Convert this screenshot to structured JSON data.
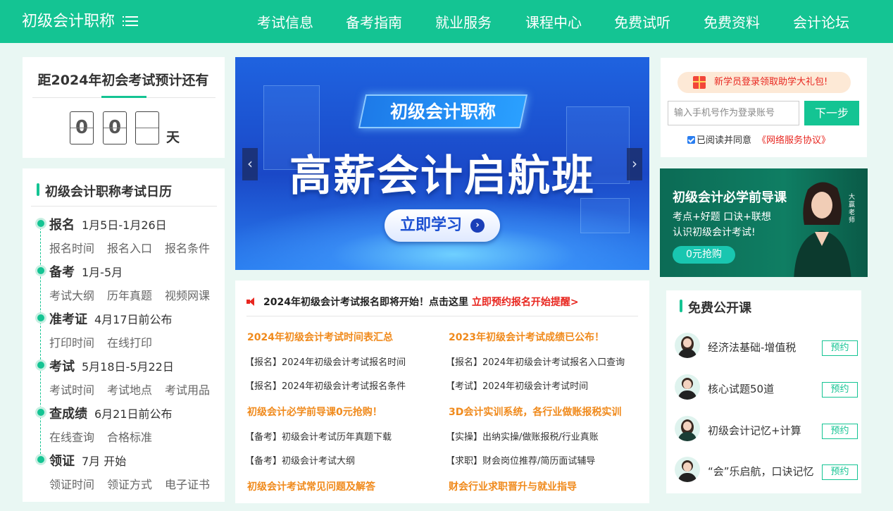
{
  "header": {
    "brand": "初级会计职称",
    "nav": [
      "考试信息",
      "备考指南",
      "就业服务",
      "课程中心",
      "免费试听",
      "免费资料",
      "会计论坛"
    ]
  },
  "countdown": {
    "title": "距2024年初会考试预计还有",
    "digits": [
      "0",
      "0",
      ""
    ],
    "unit": "天"
  },
  "calendar": {
    "title": "初级会计职称考试日历",
    "items": [
      {
        "name": "报名",
        "date": "1月5日-1月26日",
        "links": [
          "报名时间",
          "报名入口",
          "报名条件"
        ]
      },
      {
        "name": "备考",
        "date": "1月-5月",
        "links": [
          "考试大纲",
          "历年真题",
          "视频网课"
        ]
      },
      {
        "name": "准考证",
        "date": "4月17日前公布",
        "links": [
          "打印时间",
          "在线打印"
        ]
      },
      {
        "name": "考试",
        "date": "5月18日-5月22日",
        "links": [
          "考试时间",
          "考试地点",
          "考试用品"
        ]
      },
      {
        "name": "查成绩",
        "date": "6月21日前公布",
        "links": [
          "在线查询",
          "合格标准"
        ]
      },
      {
        "name": "领证",
        "date": "7月 开始",
        "links": [
          "领证时间",
          "领证方式",
          "电子证书"
        ]
      }
    ]
  },
  "banner": {
    "tag": "初级会计职称",
    "headline": "高薪会计启航班",
    "cta": "立即学习",
    "prev": "‹",
    "next": "›"
  },
  "news": {
    "notice": "2024年初级会计考试报名即将开始！点击这里",
    "notice_link": "立即预约报名开始提醒>",
    "left": [
      {
        "type": "h",
        "text": "2024年初级会计考试时间表汇总"
      },
      {
        "type": "i",
        "text": "【报名】2024年初级会计考试报名时间"
      },
      {
        "type": "i",
        "text": "【报名】2024年初级会计考试报名条件"
      },
      {
        "type": "h",
        "text": "初级会计必学前导课0元抢购！"
      },
      {
        "type": "i",
        "text": "【备考】初级会计考试历年真题下载"
      },
      {
        "type": "i",
        "text": "【备考】初级会计考试大纲"
      },
      {
        "type": "h",
        "text": "初级会计考试常见问题及解答"
      }
    ],
    "right": [
      {
        "type": "h",
        "text": "2023年初级会计考试成绩已公布！"
      },
      {
        "type": "i",
        "text": "【报名】2024年初级会计考试报名入口查询"
      },
      {
        "type": "i",
        "text": "【考试】2024年初级会计考试时间"
      },
      {
        "type": "h",
        "text": "3D会计实训系统，各行业做账报税实训"
      },
      {
        "type": "i",
        "text": "【实操】出纳实操/做账报税/行业真账"
      },
      {
        "type": "i",
        "text": "【求职】财会岗位推荐/简历面试辅导"
      },
      {
        "type": "h",
        "text": "财会行业求职晋升与就业指导"
      }
    ]
  },
  "login": {
    "gift_text": "新学员登录领取助学大礼包!",
    "phone_placeholder": "输入手机号作为登录账号",
    "next_label": "下一步",
    "agree_text": "已阅读并同意",
    "agree_link": "《网络服务协议》"
  },
  "promo": {
    "title": "初级会计必学前导课",
    "line1": "考点+好题 口诀+联想",
    "line2": "认识初级会计考试!",
    "button": "0元抢购",
    "teacher_label": "大赢老师"
  },
  "free_courses": {
    "title": "免费公开课",
    "button_label": "预约",
    "items": [
      "经济法基础-增值税",
      "核心试题50道",
      "初级会计记忆+计算",
      "“会”乐启航，口诀记忆"
    ]
  },
  "colors": {
    "brand": "#14c493",
    "highlight": "#f08a1c",
    "alert": "#e8261f"
  }
}
